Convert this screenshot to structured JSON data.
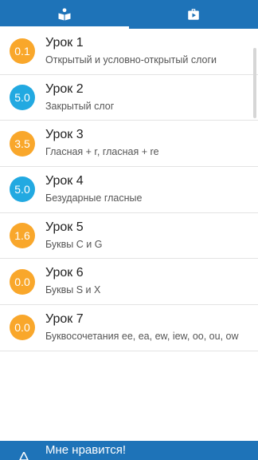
{
  "tabs": [
    {
      "icon": "book-reader-icon",
      "active": true
    },
    {
      "icon": "play-case-icon",
      "active": false
    }
  ],
  "colors": {
    "primary": "#1e73b8",
    "score_orange": "#f9a72b",
    "score_blue": "#22a9e1"
  },
  "lessons": [
    {
      "score": "0.1",
      "title": "Урок 1",
      "subtitle": "Открытый и условно-открытый слоги",
      "badge_color": "#f9a72b"
    },
    {
      "score": "5.0",
      "title": "Урок 2",
      "subtitle": "Закрытый слог",
      "badge_color": "#22a9e1"
    },
    {
      "score": "3.5",
      "title": "Урок 3",
      "subtitle": "Гласная + r, гласная + re",
      "badge_color": "#f9a72b"
    },
    {
      "score": "5.0",
      "title": "Урок 4",
      "subtitle": "Безударные гласные",
      "badge_color": "#22a9e1"
    },
    {
      "score": "1.6",
      "title": "Урок 5",
      "subtitle": "Буквы C и G",
      "badge_color": "#f9a72b"
    },
    {
      "score": "0.0",
      "title": "Урок 6",
      "subtitle": "Буквы S и X",
      "badge_color": "#f9a72b"
    },
    {
      "score": "0.0",
      "title": "Урок 7",
      "subtitle": "Буквосочетания ee, ea, ew, iew, oo, ou, ow",
      "badge_color": "#f9a72b"
    }
  ],
  "banner": {
    "label": "Мне нравится!",
    "icon": "thumbs-up-icon"
  }
}
